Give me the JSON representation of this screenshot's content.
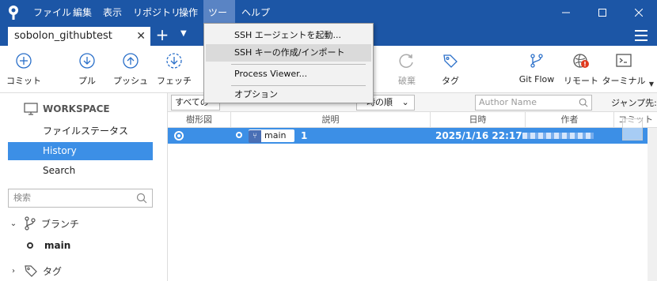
{
  "menubar": {
    "items": [
      "ファイル",
      "編集",
      "表示",
      "リポジトリ",
      "操作",
      "ツール",
      "ヘルプ"
    ]
  },
  "tabs": {
    "repo_tab": "sobolon_githubtest",
    "close_glyph": "✕",
    "add_glyph": "+",
    "dropdown_glyph": "▼"
  },
  "toolbar": {
    "commit": "コミット",
    "pull": "プル",
    "push": "プッシュ",
    "fetch": "フェッチ",
    "discard": "破棄",
    "tag": "タグ",
    "gitflow": "Git Flow",
    "remote": "リモート",
    "terminal": "ターミナル"
  },
  "sidebar": {
    "workspace": "WORKSPACE",
    "file_status": "ファイルステータス",
    "history": "History",
    "search": "Search",
    "search_placeholder": "検索",
    "branches": "ブランチ",
    "branch_main": "main",
    "tags": "タグ"
  },
  "filterbar": {
    "branch_filter": "すべての",
    "order": "時の順",
    "author_placeholder": "Author Name",
    "jump_to": "ジャンプ先:"
  },
  "columns": {
    "graph": "樹形図",
    "description": "説明",
    "date": "日時",
    "author": "作者",
    "commit": "コミット"
  },
  "commits": [
    {
      "branch": "main",
      "message": "1",
      "date": "2025/1/16 22:17"
    }
  ],
  "tools_menu": {
    "items": [
      "SSH エージェントを起動...",
      "SSH キーの作成/インポート",
      "Process Viewer...",
      "オプション"
    ]
  },
  "colors": {
    "titlebar": "#1c56a6",
    "selection": "#3c8fe6",
    "notification": "#e03a1e"
  },
  "icons": [
    "app-logo",
    "commit-icon",
    "pull-icon",
    "push-icon",
    "fetch-icon",
    "discard-icon",
    "tag-icon",
    "gitflow-icon",
    "remote-icon",
    "terminal-icon",
    "monitor-icon",
    "search-icon",
    "branch-icon",
    "tag-section-icon"
  ]
}
